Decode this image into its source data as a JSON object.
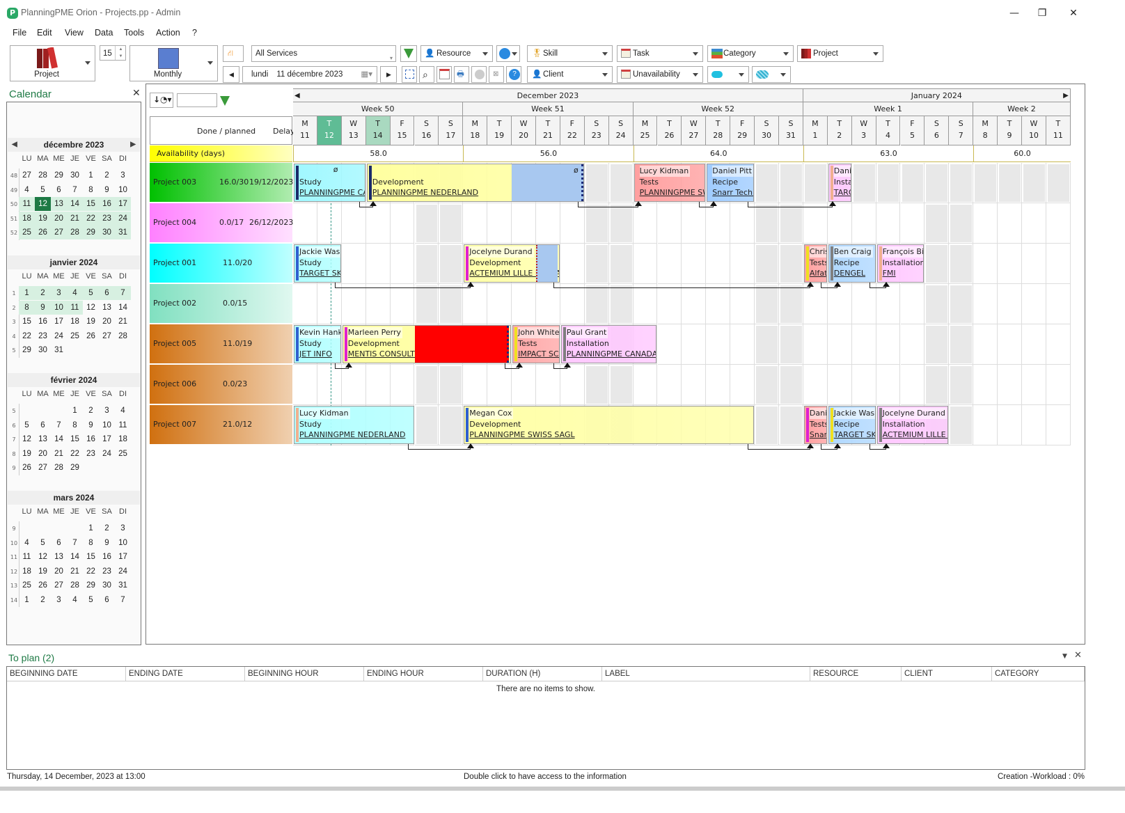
{
  "window": {
    "title": "PlanningPME Orion - Projects.pp - Admin",
    "app_icon": "P"
  },
  "menu": [
    "File",
    "Edit",
    "View",
    "Data",
    "Tools",
    "Action",
    "?"
  ],
  "toolbar": {
    "view_selector": "Project",
    "rows_count": "15",
    "period_selector": "Monthly",
    "services_dropdown": "All Services",
    "date_day": "lundi",
    "date_value": "11 décembre 2023",
    "filters_row1": [
      "Resource",
      "Skill",
      "Task",
      "Category",
      "Project"
    ],
    "filters_row2": [
      "Client",
      "Unavailability"
    ]
  },
  "calendar": {
    "title": "Calendar",
    "dow": [
      "LU",
      "MA",
      "ME",
      "JE",
      "VE",
      "SA",
      "DI"
    ],
    "months": [
      {
        "name": "décembre 2023",
        "weeks": [
          {
            "wk": "48",
            "days": [
              "27",
              "28",
              "29",
              "30",
              "1",
              "2",
              "3"
            ]
          },
          {
            "wk": "49",
            "days": [
              "4",
              "5",
              "6",
              "7",
              "8",
              "9",
              "10"
            ]
          },
          {
            "wk": "50",
            "days": [
              "11",
              "12",
              "13",
              "14",
              "15",
              "16",
              "17"
            ]
          },
          {
            "wk": "51",
            "days": [
              "18",
              "19",
              "20",
              "21",
              "22",
              "23",
              "24"
            ]
          },
          {
            "wk": "52",
            "days": [
              "25",
              "26",
              "27",
              "28",
              "29",
              "30",
              "31"
            ]
          }
        ]
      },
      {
        "name": "janvier 2024",
        "weeks": [
          {
            "wk": "1",
            "days": [
              "1",
              "2",
              "3",
              "4",
              "5",
              "6",
              "7"
            ]
          },
          {
            "wk": "2",
            "days": [
              "8",
              "9",
              "10",
              "11",
              "12",
              "13",
              "14"
            ]
          },
          {
            "wk": "3",
            "days": [
              "15",
              "16",
              "17",
              "18",
              "19",
              "20",
              "21"
            ]
          },
          {
            "wk": "4",
            "days": [
              "22",
              "23",
              "24",
              "25",
              "26",
              "27",
              "28"
            ]
          },
          {
            "wk": "5",
            "days": [
              "29",
              "30",
              "31",
              "",
              "",
              "",
              ""
            ]
          }
        ]
      },
      {
        "name": "février 2024",
        "weeks": [
          {
            "wk": "5",
            "days": [
              "",
              "",
              "",
              "1",
              "2",
              "3",
              "4"
            ]
          },
          {
            "wk": "6",
            "days": [
              "5",
              "6",
              "7",
              "8",
              "9",
              "10",
              "11"
            ]
          },
          {
            "wk": "7",
            "days": [
              "12",
              "13",
              "14",
              "15",
              "16",
              "17",
              "18"
            ]
          },
          {
            "wk": "8",
            "days": [
              "19",
              "20",
              "21",
              "22",
              "23",
              "24",
              "25"
            ]
          },
          {
            "wk": "9",
            "days": [
              "26",
              "27",
              "28",
              "29",
              "",
              "",
              ""
            ]
          }
        ]
      },
      {
        "name": "mars 2024",
        "weeks": [
          {
            "wk": "9",
            "days": [
              "",
              "",
              "",
              "",
              "1",
              "2",
              "3"
            ]
          },
          {
            "wk": "10",
            "days": [
              "4",
              "5",
              "6",
              "7",
              "8",
              "9",
              "10"
            ]
          },
          {
            "wk": "11",
            "days": [
              "11",
              "12",
              "13",
              "14",
              "15",
              "16",
              "17"
            ]
          },
          {
            "wk": "12",
            "days": [
              "18",
              "19",
              "20",
              "21",
              "22",
              "23",
              "24"
            ]
          },
          {
            "wk": "13",
            "days": [
              "25",
              "26",
              "27",
              "28",
              "29",
              "30",
              "31"
            ]
          },
          {
            "wk": "14",
            "days": [
              "1",
              "2",
              "3",
              "4",
              "5",
              "6",
              "7"
            ]
          }
        ]
      }
    ],
    "selected_day": "12"
  },
  "gantt": {
    "col_done_planned": "Done / planned",
    "col_delay": "Delay",
    "availability_label": "Availability (days)",
    "months": [
      {
        "label": "December 2023"
      },
      {
        "label": "January 2024"
      }
    ],
    "weeks": [
      {
        "label": "Week 50",
        "availability": "58.0"
      },
      {
        "label": "Week 51",
        "availability": "56.0"
      },
      {
        "label": "Week 52",
        "availability": "64.0"
      },
      {
        "label": "Week 1",
        "availability": "63.0"
      },
      {
        "label": "Week 2",
        "availability": "60.0"
      }
    ],
    "days": [
      [
        "M",
        "11"
      ],
      [
        "T",
        "12"
      ],
      [
        "W",
        "13"
      ],
      [
        "T",
        "14"
      ],
      [
        "F",
        "15"
      ],
      [
        "S",
        "16"
      ],
      [
        "S",
        "17"
      ],
      [
        "M",
        "18"
      ],
      [
        "T",
        "19"
      ],
      [
        "W",
        "20"
      ],
      [
        "T",
        "21"
      ],
      [
        "F",
        "22"
      ],
      [
        "S",
        "23"
      ],
      [
        "S",
        "24"
      ],
      [
        "M",
        "25"
      ],
      [
        "T",
        "26"
      ],
      [
        "W",
        "27"
      ],
      [
        "T",
        "28"
      ],
      [
        "F",
        "29"
      ],
      [
        "S",
        "30"
      ],
      [
        "S",
        "31"
      ],
      [
        "M",
        "1"
      ],
      [
        "T",
        "2"
      ],
      [
        "W",
        "3"
      ],
      [
        "T",
        "4"
      ],
      [
        "F",
        "5"
      ],
      [
        "S",
        "6"
      ],
      [
        "S",
        "7"
      ],
      [
        "M",
        "8"
      ],
      [
        "T",
        "9"
      ],
      [
        "W",
        "10"
      ],
      [
        "T",
        "11"
      ]
    ],
    "projects": [
      {
        "name": "Project 003",
        "done_planned": "16.0/30",
        "delay": "19/12/2023",
        "color_from": "#00c000",
        "color_to": "#b0ecb0"
      },
      {
        "name": "Project 004",
        "done_planned": "0.0/17",
        "delay": "26/12/2023",
        "color_from": "#ff80ff",
        "color_to": "#ffe0ff"
      },
      {
        "name": "Project 001",
        "done_planned": "11.0/20",
        "delay": "",
        "color_from": "#00ffff",
        "color_to": "#c0ffff"
      },
      {
        "name": "Project 002",
        "done_planned": "0.0/15",
        "delay": "",
        "color_from": "#80e0c0",
        "color_to": "#e0f8f0"
      },
      {
        "name": "Project 005",
        "done_planned": "11.0/19",
        "delay": "",
        "color_from": "#d07010",
        "color_to": "#f0d0b0"
      },
      {
        "name": "Project 006",
        "done_planned": "0.0/23",
        "delay": "",
        "color_from": "#d07010",
        "color_to": "#f0d0b0"
      },
      {
        "name": "Project 007",
        "done_planned": "21.0/12",
        "delay": "",
        "color_from": "#d07010",
        "color_to": "#f0d0b0"
      }
    ],
    "tasks": [
      {
        "row": 0,
        "start": 0,
        "end": 3,
        "resource": "",
        "label": "Study",
        "client": "PLANNINGPME CANADA",
        "bg": "#a0f8ff",
        "bar": "#1a2a6a"
      },
      {
        "row": 0,
        "start": 3,
        "end": 12,
        "resource": "",
        "label": "Development",
        "client": "PLANNINGPME NEDERLAND",
        "bg": "#ffffa0",
        "bar": "#1a2a6a"
      },
      {
        "row": 0,
        "start": 14,
        "end": 17,
        "resource": "Lucy Kidman",
        "label": "Tests",
        "client": "PLANNINGPME SWISS",
        "bg": "#ffa0a0",
        "bar": "#ffa0a0"
      },
      {
        "row": 0,
        "start": 17,
        "end": 19,
        "resource": "Daniel Pitt",
        "label": "Recipe",
        "client": "Snarr Technol",
        "bg": "#a0ccff",
        "bar": "#a0ccff"
      },
      {
        "row": 0,
        "start": 22,
        "end": 23,
        "resource": "Daniel",
        "label": "Installation",
        "client": "TARGET",
        "bg": "#ffc8ff",
        "bar": "#f0b090"
      },
      {
        "row": 2,
        "start": 0,
        "end": 2,
        "resource": "Jackie Wash",
        "label": "Study",
        "client": "TARGET SKIL",
        "bg": "#b0ffff",
        "bar": "#3060d0"
      },
      {
        "row": 2,
        "start": 7,
        "end": 11,
        "resource": "Jocelyne Durand",
        "label": "Development",
        "client": "ACTEMIUM LILLE DIGITAL SOLUTIONS",
        "bg": "#ffffa8",
        "bar": "#e020d0"
      },
      {
        "row": 2,
        "start": 21,
        "end": 22,
        "resource": "Chris",
        "label": "Tests",
        "client": "Alfatec",
        "bg": "#ffa0a0",
        "bar": "#f0e020"
      },
      {
        "row": 2,
        "start": 22,
        "end": 24,
        "resource": "Ben Craig",
        "label": "Recipe",
        "client": "DENGEL",
        "bg": "#b0d8ff",
        "bar": "#808080"
      },
      {
        "row": 2,
        "start": 24,
        "end": 26,
        "resource": "François Bit",
        "label": "Installation",
        "client": "FMI",
        "bg": "#ffc8ff",
        "bar": "#f0b090"
      },
      {
        "row": 4,
        "start": 0,
        "end": 2,
        "resource": "Kevin Hanks",
        "label": "Study",
        "client": "JET INFO",
        "bg": "#b0ffff",
        "bar": "#3060d0"
      },
      {
        "row": 4,
        "start": 2,
        "end": 9,
        "resource": "Marleen Perry",
        "label": "Development",
        "client": "MENTIS CONSULTING",
        "bg": "#ffffa0",
        "bar": "#e020d0"
      },
      {
        "row": 4,
        "start": 9,
        "end": 11,
        "resource": "John White",
        "label": "Tests",
        "client": "IMPACT SCHEDULING",
        "bg": "#ffa8a8",
        "bar": "#f0e020"
      },
      {
        "row": 4,
        "start": 11,
        "end": 15,
        "resource": "Paul Grant",
        "label": "Installation",
        "client": "PLANNINGPME CANADA",
        "bg": "#ffc8ff",
        "bar": "#808080"
      },
      {
        "row": 6,
        "start": 0,
        "end": 5,
        "resource": "Lucy Kidman",
        "label": "Study",
        "client": "PLANNINGPME NEDERLAND",
        "bg": "#b0ffff",
        "bar": "#f0b090"
      },
      {
        "row": 6,
        "start": 7,
        "end": 19,
        "resource": "Megan Cox",
        "label": "Development",
        "client": "PLANNINGPME SWISS SAGL",
        "bg": "#ffffa8",
        "bar": "#3060d0"
      },
      {
        "row": 6,
        "start": 21,
        "end": 22,
        "resource": "Daniel",
        "label": "Tests",
        "client": "Snarr",
        "bg": "#ffa0a0",
        "bar": "#e020d0"
      },
      {
        "row": 6,
        "start": 22,
        "end": 24,
        "resource": "Jackie Wash",
        "label": "Recipe",
        "client": "TARGET SKIL",
        "bg": "#b0d8ff",
        "bar": "#f0e020"
      },
      {
        "row": 6,
        "start": 24,
        "end": 27,
        "resource": "Jocelyne Durand",
        "label": "Installation",
        "client": "ACTEMIUM LILLE DIGITAL",
        "bg": "#ffc8ff",
        "bar": "#808080"
      }
    ]
  },
  "toplan": {
    "title": "To plan (2)",
    "columns": [
      "BEGINNING DATE",
      "ENDING DATE",
      "BEGINNING HOUR",
      "ENDING HOUR",
      "DURATION (H)",
      "LABEL",
      "RESOURCE",
      "CLIENT",
      "CATEGORY"
    ],
    "empty_message": "There are no items to show."
  },
  "status": {
    "left": "Thursday, 14 December, 2023 at 13:00",
    "center": "Double click to have access to the information",
    "right": "Creation -Workload : 0%"
  }
}
